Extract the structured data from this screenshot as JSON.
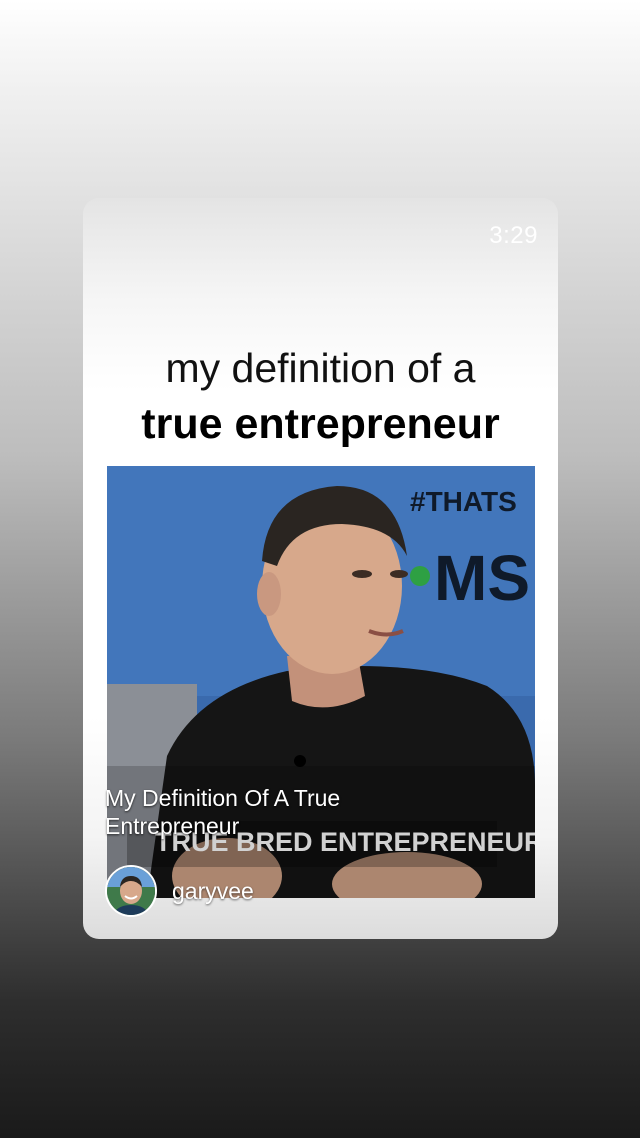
{
  "story": {
    "duration": "3:29",
    "headline_line1": "my definition of a",
    "headline_line2": "true entrepreneur"
  },
  "video": {
    "title": "My Definition Of A True Entrepreneur",
    "backdrop_hashtag": "#THATS",
    "backdrop_logo_text": "MS",
    "lower_third_caption": "TRUE BRED ENTREPRENEUR",
    "channel": "garyvee",
    "thumbnail_icon": "person-thumbnail-icon",
    "avatar_icon": "channel-avatar-icon"
  },
  "colors": {
    "backdrop_blue": "#3f6fb0",
    "logo_green": "#2ea043",
    "shirt": "#151515",
    "skin": "#d7a88b"
  }
}
